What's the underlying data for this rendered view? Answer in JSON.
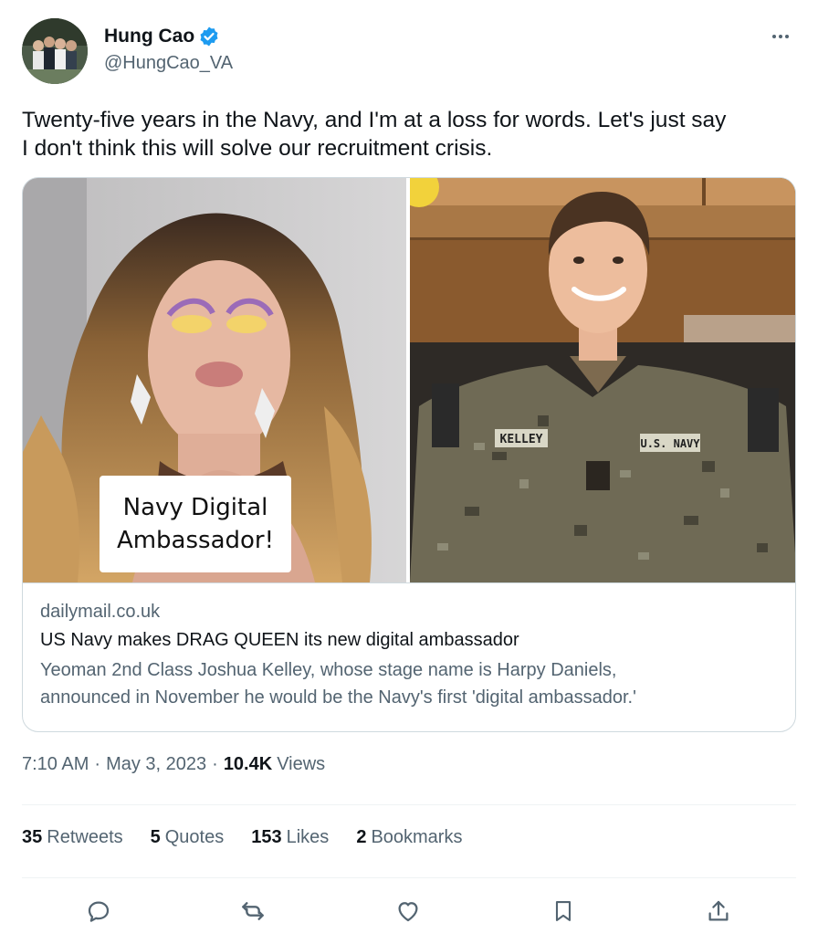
{
  "author": {
    "display_name": "Hung Cao",
    "handle": "@HungCao_VA",
    "verified": true
  },
  "tweet": {
    "text_line1": "Twenty-five years in the Navy, and I'm at a loss for words. Let's just say",
    "text_line2": "I don't think this will solve our recruitment crisis."
  },
  "card": {
    "image_caption_line1": "Navy Digital",
    "image_caption_line2": "Ambassador!",
    "uniform_name_tag": "KELLEY",
    "uniform_branch_tag": "U.S. NAVY",
    "domain": "dailymail.co.uk",
    "title": "US Navy makes DRAG QUEEN its new digital ambassador",
    "description_line1": "Yeoman 2nd Class Joshua Kelley, whose stage name is Harpy Daniels,",
    "description_line2": "announced in November he would be the Navy's first 'digital ambassador.'"
  },
  "meta": {
    "time": "7:10 AM",
    "separator": "·",
    "date": "May 3, 2023",
    "views_count": "10.4K",
    "views_label": "Views"
  },
  "stats": {
    "retweets_count": "35",
    "retweets_label": "Retweets",
    "quotes_count": "5",
    "quotes_label": "Quotes",
    "likes_count": "153",
    "likes_label": "Likes",
    "bookmarks_count": "2",
    "bookmarks_label": "Bookmarks"
  },
  "icons": {
    "more": "more-horizontal-icon",
    "verified": "verified-badge-icon",
    "reply": "reply-icon",
    "retweet": "retweet-icon",
    "like": "heart-icon",
    "bookmark": "bookmark-icon",
    "share": "share-icon"
  },
  "colors": {
    "text_primary": "#0f1419",
    "text_secondary": "#536471",
    "verified_blue": "#1d9bf0",
    "border": "#cfd9de"
  }
}
